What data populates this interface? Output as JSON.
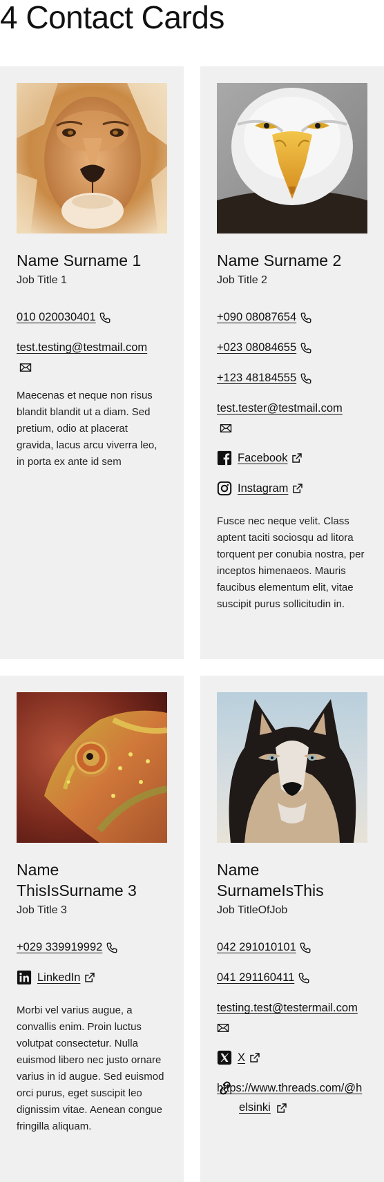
{
  "page": {
    "title": "4 Contact Cards"
  },
  "cards": [
    {
      "name": "Name Surname 1",
      "job": "Job Title 1",
      "photo_alt": "lion",
      "phones": [
        "010 020030401"
      ],
      "email": "test.testing@testmail.com",
      "description": "Maecenas et neque non risus blandit blandit ut a diam. Sed pretium, odio at placerat gravida, lacus arcu viverra leo, in porta ex ante id sem"
    },
    {
      "name": "Name Surname 2",
      "job": "Job Title 2",
      "photo_alt": "eagle",
      "phones": [
        "+090 08087654",
        "+023 08084655",
        "+123 48184555"
      ],
      "email": "test.tester@testmail.com",
      "socials": [
        {
          "icon": "facebook-icon",
          "label": "Facebook"
        },
        {
          "icon": "instagram-icon",
          "label": "Instagram"
        }
      ],
      "description": "Fusce nec neque velit. Class aptent taciti sociosqu ad litora torquent per conubia nostra, per inceptos himenaeos. Mauris faucibus elementum elit, vitae suscipit purus sollicitudin in."
    },
    {
      "name": "Name ThisIsSurname 3",
      "job": "Job Title 3",
      "photo_alt": "chameleon",
      "phones": [
        "+029 339919992"
      ],
      "socials": [
        {
          "icon": "linkedin-icon",
          "label": "LinkedIn"
        }
      ],
      "description": "Morbi vel varius augue, a convallis enim. Proin luctus volutpat consectetur. Nulla euismod libero nec justo ornare varius in id augue. Sed euismod orci purus, eget suscipit leo dignissim vitae. Aenean congue fringilla aliquam."
    },
    {
      "name": "Name SurnameIsThis",
      "job": "Job TitleOfJob",
      "photo_alt": "husky",
      "phones": [
        "042 291010101",
        "041 291160411"
      ],
      "email": "testing.test@testermail.com",
      "socials": [
        {
          "icon": "x-icon",
          "label": "X"
        },
        {
          "icon": "link-icon",
          "label": "https://www.threads.com/@helsinki"
        }
      ]
    }
  ],
  "colors": {
    "card_bg": "#f0f0f0",
    "text": "#111111",
    "page_bg": "#ffffff"
  }
}
